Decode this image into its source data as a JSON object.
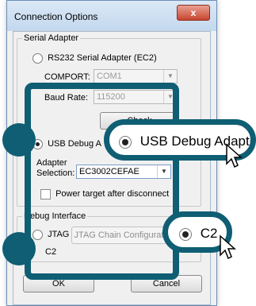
{
  "window": {
    "title": "Connection Options",
    "close_glyph": "x"
  },
  "serial_adapter": {
    "group_label": "Serial Adapter",
    "radio_label": "RS232 Serial Adapter (EC2)",
    "comport_label": "COMPORT:",
    "comport_value": "COM1",
    "baud_label": "Baud Rate:",
    "baud_value": "115200"
  },
  "usb": {
    "check_button_label": "Check",
    "radio_label": "USB Debug A",
    "adapter_label_line1": "Adapter",
    "adapter_label_line2": "Selection:",
    "adapter_value": "EC3002CEFAE",
    "power_checkbox_label": "Power target after disconnect"
  },
  "debug_interface": {
    "group_label": "Debug Interface",
    "jtag_label": "JTAG",
    "jtag_button_label": "JTAG Chain Configurat",
    "c2_label": "C2"
  },
  "footer": {
    "ok_label": "OK",
    "cancel_label": "Cancel"
  },
  "callouts": {
    "usb_label": "USB Debug Adapter",
    "c2_label": "C2"
  },
  "colors": {
    "highlight": "#0f5e73"
  }
}
